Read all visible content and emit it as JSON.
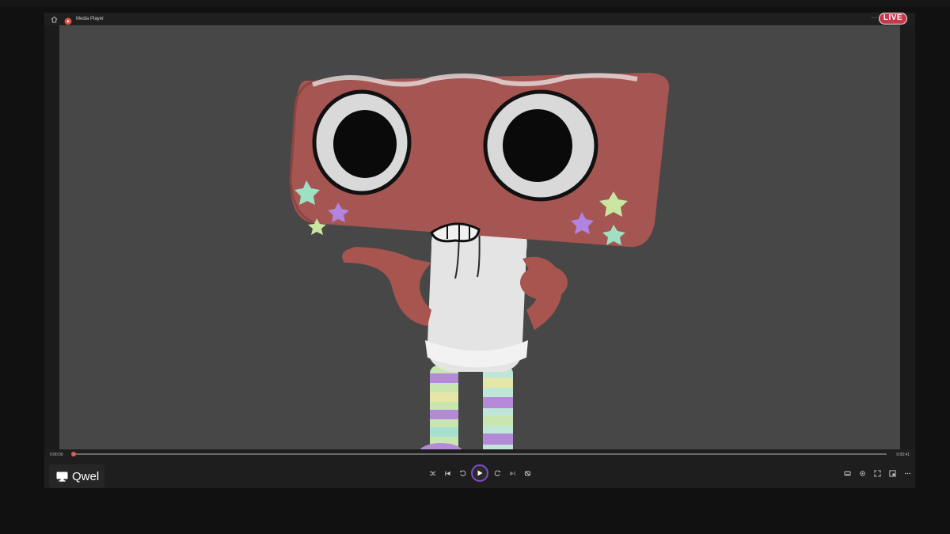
{
  "window": {
    "title": "Media Player",
    "more": "···",
    "live_badge": "LIVE"
  },
  "player": {
    "time_elapsed": "0:00:00",
    "time_total": "0:00:41",
    "progress": 0.0
  },
  "overlay": {
    "label": "Qwel"
  },
  "colors": {
    "accent": "#7f4cc9",
    "live": "#c8374b",
    "video_background": "#474747",
    "character_body": "#a85550"
  },
  "icons": {
    "home": "home-icon",
    "app": "media-player-icon",
    "shuffle": "shuffle-icon",
    "previous": "previous-icon",
    "rewind": "rewind-icon",
    "play": "play-icon",
    "forward": "forward-icon",
    "next": "next-icon",
    "repeat": "repeat-icon",
    "captions": "captions-icon",
    "cast": "cast-icon",
    "fullscreen": "fullscreen-icon",
    "miniplayer": "miniplayer-icon",
    "more": "more-icon",
    "screen": "screen-icon"
  }
}
